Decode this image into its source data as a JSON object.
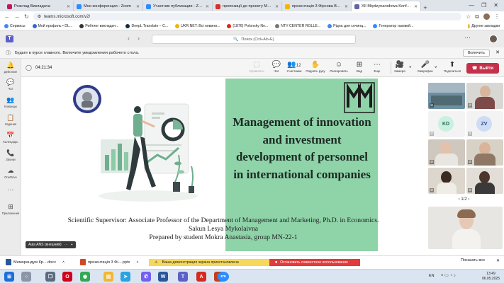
{
  "browser": {
    "tabs": [
      {
        "label": "Розклад Викладача",
        "color": "#c2185b",
        "active": false
      },
      {
        "label": "Мои конференции - Zoom",
        "color": "#2d8cff",
        "active": false
      },
      {
        "label": "Участник публикации - Zoom",
        "color": "#2d8cff",
        "active": false
      },
      {
        "label": "пропозиції до проекту Меморандуму",
        "color": "#d93025",
        "active": false
      },
      {
        "label": "презентація 3 Фірсова Вероніка",
        "color": "#f4b400",
        "active": false
      },
      {
        "label": "XII Międzynarodowa Konferencja",
        "color": "#6264a7",
        "active": true
      }
    ],
    "url": "teams.microsoft.com/v2/",
    "bookmarks": [
      "Сервисы",
      "Мой профиль • DL...",
      "Рейтинг викладач...",
      "DeepL Translate – С...",
      "UKR.NET: Всі новини...",
      "(1876) Polonsky Ne...",
      "NTY CENTER ROLLE...",
      "Рідна для сочинц...",
      "Генератор газовий..."
    ],
    "bookmarks_other": "Другие закладки"
  },
  "teams": {
    "search_placeholder": "Поиск (Ctrl+Alt+E)",
    "notice": "Будьте в курсе главного. Включите уведомления рабочего стола.",
    "notice_button": "Включить",
    "rail": [
      {
        "icon": "bell-icon",
        "label": "Действие",
        "glyph": "🔔"
      },
      {
        "icon": "chat-icon",
        "label": "Чат",
        "glyph": "💬"
      },
      {
        "icon": "teams-icon",
        "label": "Команды",
        "glyph": "👥"
      },
      {
        "icon": "tasks-icon",
        "label": "Задания",
        "glyph": "📋"
      },
      {
        "icon": "calendar-icon",
        "label": "Календарь",
        "glyph": "📅"
      },
      {
        "icon": "calls-icon",
        "label": "Звонки",
        "glyph": "📞"
      },
      {
        "icon": "onedrive-icon",
        "label": "OneDrive",
        "glyph": "☁"
      },
      {
        "icon": "apps-icon",
        "label": "Приложения",
        "glyph": "⊞"
      }
    ],
    "timer": "04:21:34",
    "toolbar": [
      {
        "icon": "share-icon",
        "label": "Управлять",
        "glyph": "⬚",
        "dim": true
      },
      {
        "icon": "chat-bubble-icon",
        "label": "Чат",
        "glyph": "💬",
        "dim": false
      },
      {
        "icon": "participants-icon",
        "label": "Участники",
        "glyph": "👥",
        "dim": false
      },
      {
        "icon": "raise-hand-icon",
        "label": "Поднять руку",
        "glyph": "✋",
        "dim": false
      },
      {
        "icon": "react-icon",
        "label": "Реагировать",
        "glyph": "☺",
        "dim": false
      },
      {
        "icon": "view-icon",
        "label": "Вид",
        "glyph": "⊞",
        "dim": false
      },
      {
        "icon": "more-icon",
        "label": "Еще",
        "glyph": "⋯",
        "dim": false
      }
    ],
    "participant_count": "12",
    "av_controls": [
      {
        "icon": "camera-icon",
        "label": "Камера",
        "glyph": "🎥"
      },
      {
        "icon": "microphone-icon",
        "label": "Микрофон",
        "glyph": "🎤"
      },
      {
        "icon": "share-screen-icon",
        "label": "Поделиться",
        "glyph": "⬆"
      }
    ],
    "leave_label": "Выйти",
    "presenter_name": "Aula ANS (внешний)",
    "gallery_initials": [
      "KD",
      "ZV"
    ],
    "pager": "1/2"
  },
  "slide": {
    "logo_text": "MM",
    "title": "Management of innovation and investment development of personnel in international companies",
    "supervisor": "Scientific Supervisor: Associate Professor of the Department of Management and Marketing, Ph.D. in Economics. Sakun Lesya Mykolaivna",
    "student": "Prepared by student Mokra Anastasia, group MN-22-1"
  },
  "downloads": {
    "items": [
      {
        "label": "Меморандум Кр....docx",
        "color": "#2b579a"
      },
      {
        "label": "презентація 3 Фі....pptx",
        "color": "#d24726"
      }
    ],
    "share_notice": "Ваша демонстрация экрана приостановлена",
    "stop_button": "Остановить совместное использование",
    "show_all": "Показать все"
  },
  "taskbar": {
    "apps": [
      {
        "icon": "windows-start-icon",
        "color": "#1e6fd9",
        "glyph": "⊞"
      },
      {
        "icon": "search-icon",
        "color": "#5a6b80",
        "glyph": "○"
      },
      {
        "icon": "opera-icon",
        "color": "#d0021b",
        "glyph": "O"
      },
      {
        "icon": "chrome-icon",
        "color": "#34a853",
        "glyph": "◉"
      },
      {
        "icon": "explorer-icon",
        "color": "#f2b632",
        "glyph": "▤"
      },
      {
        "icon": "telegram-icon",
        "color": "#2aa3e0",
        "glyph": "➤"
      },
      {
        "icon": "viber-icon",
        "color": "#7360f2",
        "glyph": "✆"
      },
      {
        "icon": "word-icon",
        "color": "#2b579a",
        "glyph": "W"
      },
      {
        "icon": "teams-app-icon",
        "color": "#5b5fc7",
        "glyph": "T"
      },
      {
        "icon": "acrobat-icon",
        "color": "#d42a1f",
        "glyph": "A"
      },
      {
        "icon": "powerpoint-icon",
        "color": "#c43e1c",
        "glyph": "P"
      },
      {
        "icon": "zoom-icon",
        "color": "#2d8cff",
        "glyph": "zm"
      }
    ],
    "language": "EN",
    "time": "13:49",
    "date": "06.05.2025"
  }
}
